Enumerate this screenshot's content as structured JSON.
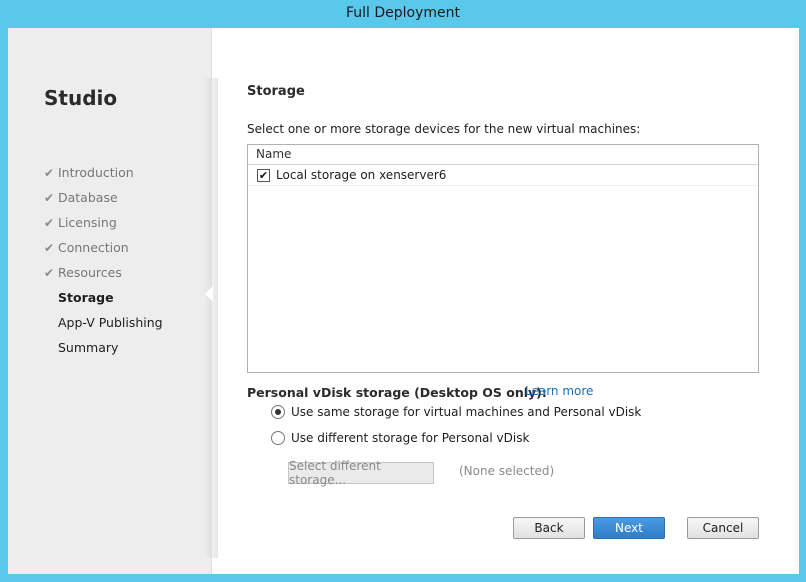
{
  "window": {
    "title": "Full Deployment"
  },
  "sidebar": {
    "title": "Studio",
    "steps": [
      {
        "label": "Introduction",
        "state": "done"
      },
      {
        "label": "Database",
        "state": "done"
      },
      {
        "label": "Licensing",
        "state": "done"
      },
      {
        "label": "Connection",
        "state": "done"
      },
      {
        "label": "Resources",
        "state": "done"
      },
      {
        "label": "Storage",
        "state": "current"
      },
      {
        "label": "App-V Publishing",
        "state": "future"
      },
      {
        "label": "Summary",
        "state": "future"
      }
    ],
    "check_glyph": "✔"
  },
  "main": {
    "section_title": "Storage",
    "instruction": "Select one or more storage devices for the new virtual machines:",
    "list": {
      "header": "Name",
      "rows": [
        {
          "label": "Local storage on xenserver6",
          "checked": true,
          "check_glyph": "✔"
        }
      ]
    },
    "vdisk": {
      "label": "Personal vDisk storage (Desktop OS only):",
      "learn_more": "Learn more",
      "options": [
        {
          "label": "Use same storage for virtual machines and Personal vDisk",
          "selected": true
        },
        {
          "label": "Use different storage for Personal vDisk",
          "selected": false
        }
      ],
      "select_button": "Select different storage...",
      "none_selected": "(None selected)"
    }
  },
  "footer": {
    "back": "Back",
    "next": "Next",
    "cancel": "Cancel"
  },
  "colors": {
    "frame_border": "#5ac8ea",
    "accent": "#2e7dc8",
    "link": "#1a6db5"
  }
}
